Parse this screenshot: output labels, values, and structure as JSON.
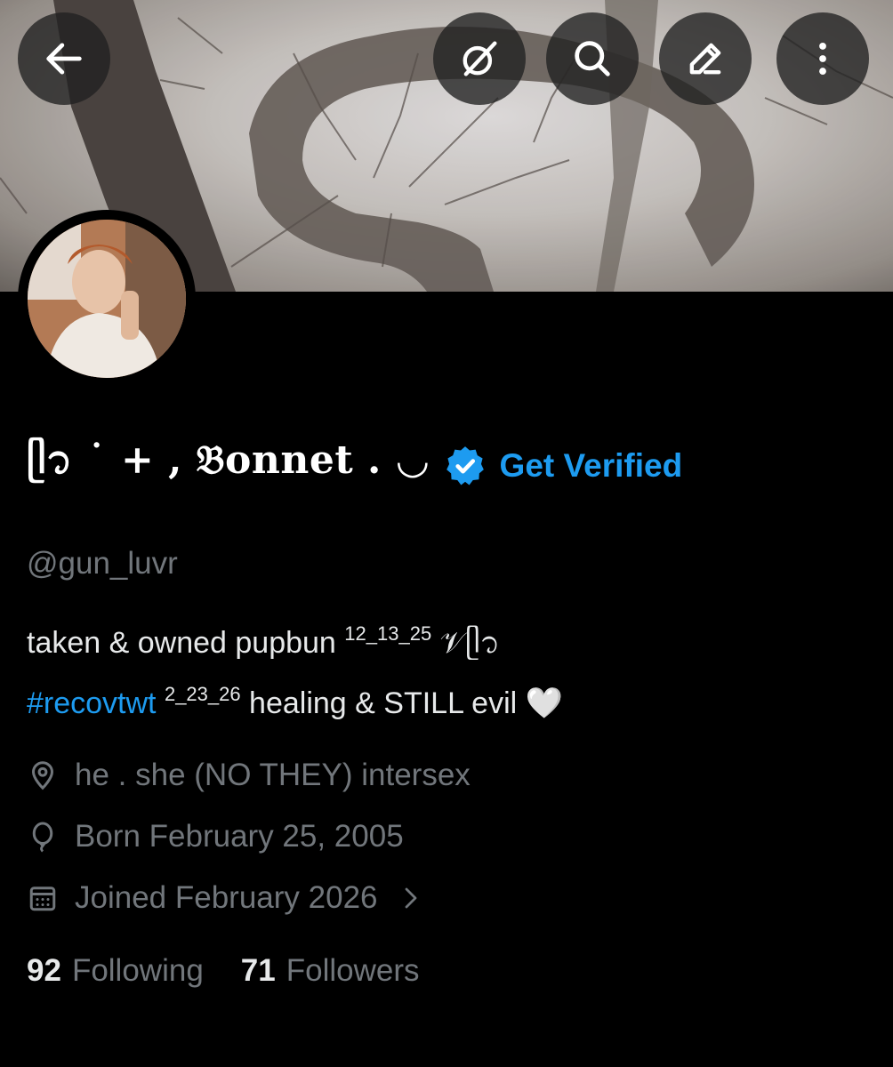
{
  "header": {
    "back_icon": "arrow-left-icon",
    "grok_icon": "grok-icon",
    "search_icon": "search-icon",
    "edit_icon": "pencil-icon",
    "more_icon": "more-vertical-icon"
  },
  "profile": {
    "display_name": "ᥫ᭡ ˙ + , 𝔅onnet . ◡",
    "verified_badge_icon": "verified-badge-icon",
    "get_verified_label": "Get Verified",
    "handle": "@gun_luvr",
    "bio": {
      "line1_text": "taken & owned pupbun ",
      "line1_sup": "12_13_25",
      "line1_tail": " 𝒱ᥫ᭡",
      "line2_hashtag": "#recovtwt",
      "line2_sup": "2_23_26",
      "line2_text": " healing & STILL evil 🤍"
    },
    "pronouns": "he . she (NO THEY) intersex",
    "birthday": "Born February 25, 2005",
    "joined": "Joined February 2026",
    "following_count": "92",
    "following_label": "Following",
    "followers_count": "71",
    "followers_label": "Followers"
  },
  "colors": {
    "accent": "#1d9bf0",
    "muted": "#71767b",
    "text": "#e7e9ea",
    "background": "#000000"
  }
}
